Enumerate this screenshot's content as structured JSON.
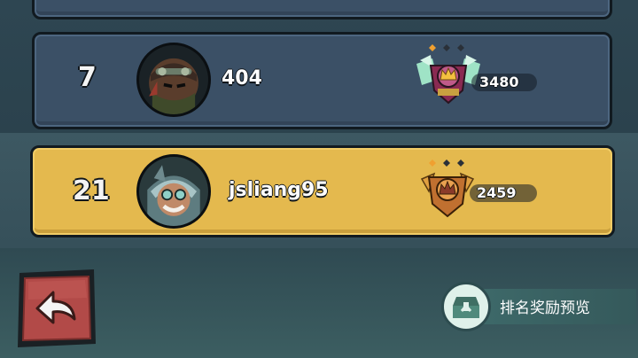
{
  "rows": [
    {
      "rank": "7",
      "name": "404",
      "score": "3480"
    },
    {
      "rank": "21",
      "name": "jsliang95",
      "score": "2459"
    }
  ],
  "footer": {
    "reward_preview_label": "排名奖励预览"
  },
  "colors": {
    "row_bg": "#3b5066",
    "highlight_bg": "#e4b94e",
    "back_button": "#b24a48"
  }
}
